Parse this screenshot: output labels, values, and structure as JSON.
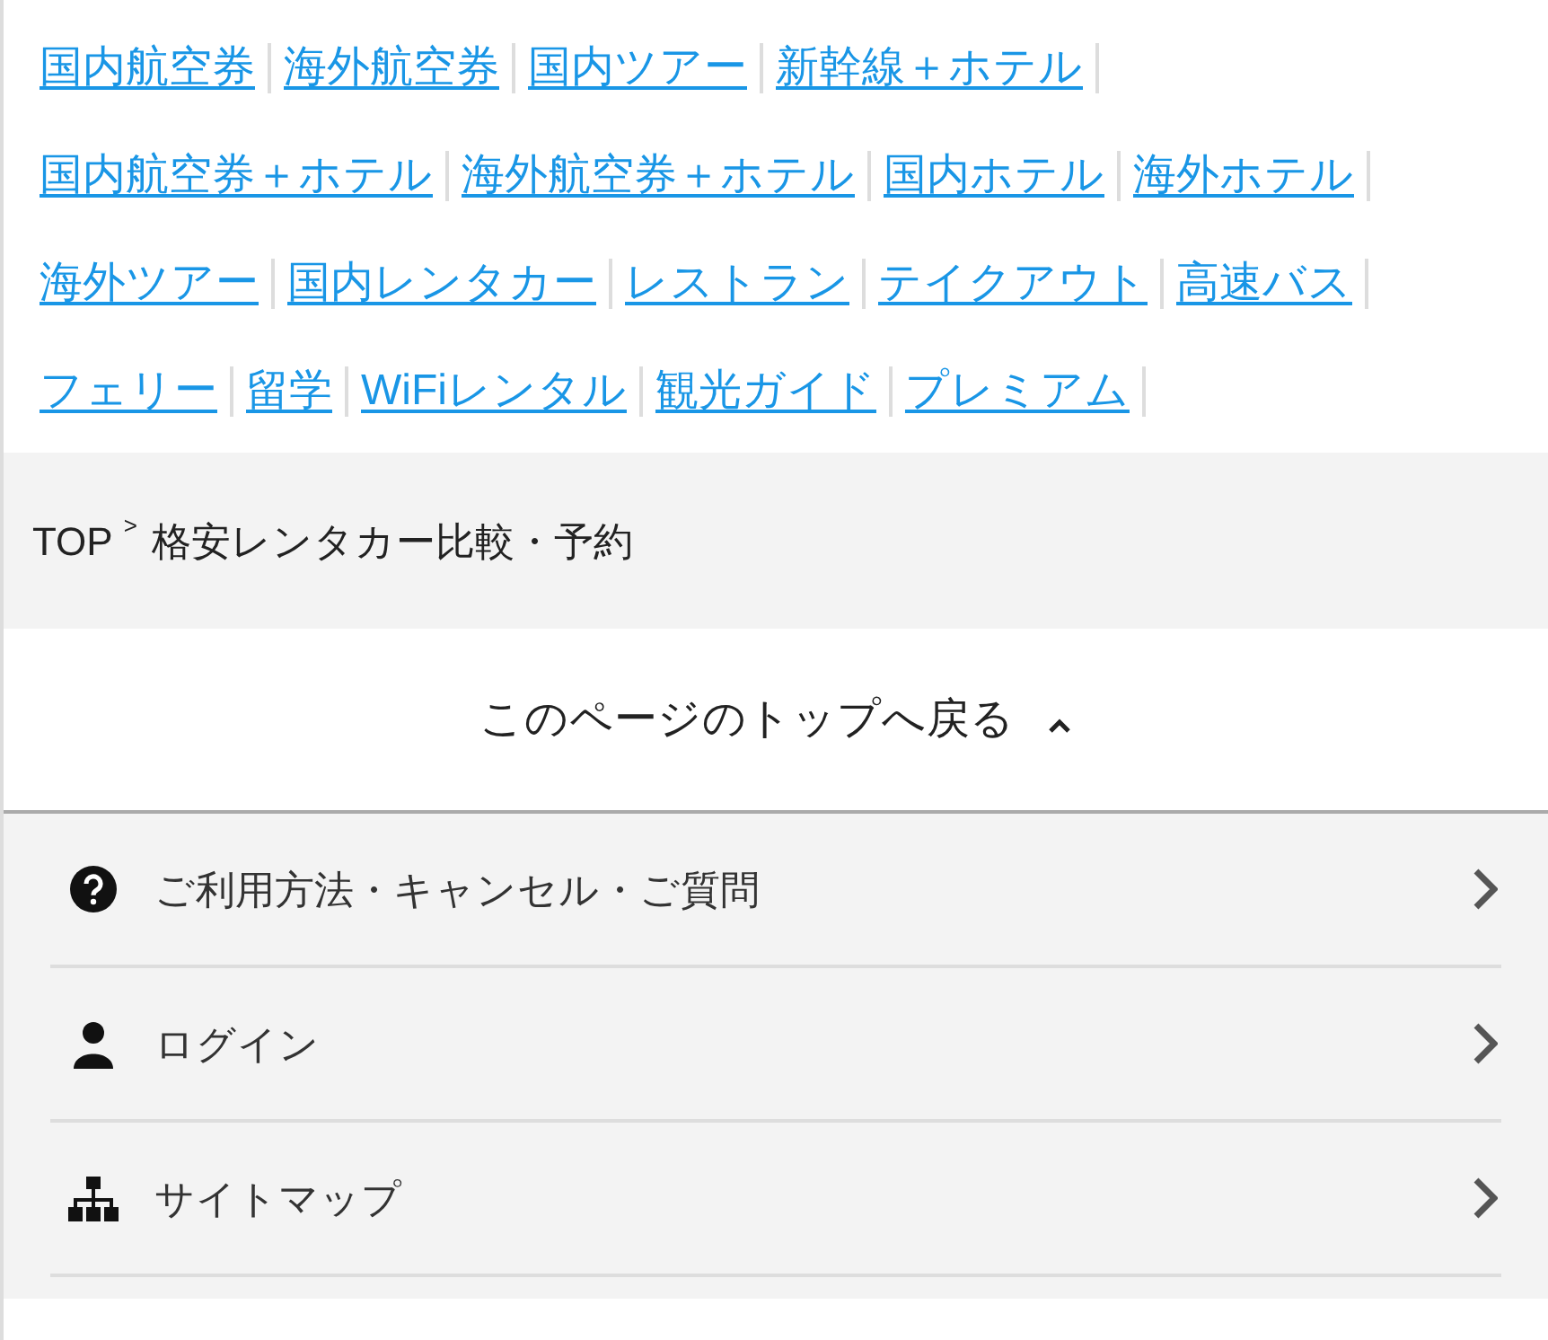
{
  "link_rows": [
    [
      "国内航空券",
      "海外航空券",
      "国内ツアー",
      "新幹線＋ホテル"
    ],
    [
      "国内航空券＋ホテル",
      "海外航空券＋ホテル",
      "国内ホテル",
      "海外ホテル"
    ],
    [
      "海外ツアー",
      "国内レンタカー",
      "レストラン",
      "テイクアウト",
      "高速バス"
    ],
    [
      "フェリー",
      "留学",
      "WiFiレンタル",
      "観光ガイド",
      "プレミアム"
    ]
  ],
  "breadcrumb": {
    "items": [
      "TOP",
      "格安レンタカー比較・予約"
    ],
    "separator": ">"
  },
  "back_to_top": "このページのトップへ戻る",
  "menu": [
    {
      "kind": "help",
      "label": "ご利用方法・キャンセル・ご質問"
    },
    {
      "kind": "user",
      "label": "ログイン"
    },
    {
      "kind": "sitemap",
      "label": "サイトマップ"
    }
  ]
}
